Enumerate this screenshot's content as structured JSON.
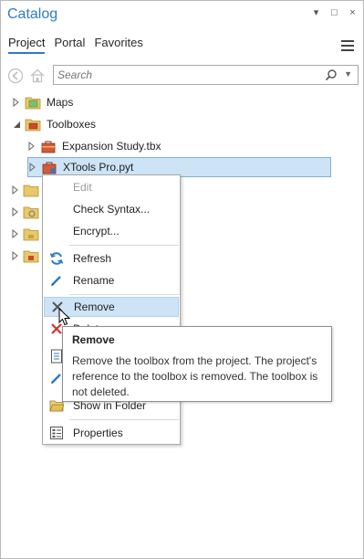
{
  "pane": {
    "title": "Catalog",
    "window_buttons": {
      "menu": "▾",
      "float": "□",
      "close": "×"
    }
  },
  "tabs": [
    {
      "label": "Project",
      "active": true
    },
    {
      "label": "Portal",
      "active": false
    },
    {
      "label": "Favorites",
      "active": false
    }
  ],
  "search": {
    "placeholder": "Search"
  },
  "tree": [
    {
      "label": "Maps",
      "icon": "maps-folder-icon"
    },
    {
      "label": "Toolboxes",
      "icon": "toolboxes-folder-icon",
      "expanded": true
    },
    {
      "label": "Expansion Study.tbx",
      "icon": "toolbox-icon"
    },
    {
      "label": "XTools Pro.pyt",
      "icon": "python-toolbox-icon",
      "selected": true
    }
  ],
  "context_menu": {
    "items": [
      {
        "label": "Edit",
        "disabled": true,
        "icon": ""
      },
      {
        "label": "Check Syntax...",
        "icon": ""
      },
      {
        "label": "Encrypt...",
        "icon": ""
      },
      {
        "label": "Refresh",
        "icon": "refresh-icon"
      },
      {
        "label": "Rename",
        "icon": "rename-icon"
      },
      {
        "label": "Remove",
        "icon": "remove-icon",
        "highlighted": true
      },
      {
        "label": "Delete",
        "icon": "delete-icon"
      },
      {
        "label": "",
        "icon": "document-icon"
      },
      {
        "label": "",
        "icon": "pencil-icon"
      },
      {
        "label": "Show in Folder",
        "icon": "folder-icon"
      },
      {
        "label": "Properties",
        "icon": "properties-icon"
      }
    ]
  },
  "tooltip": {
    "title": "Remove",
    "body": "Remove the toolbox from the project. The project's reference to the toolbox is removed. The toolbox is not deleted."
  },
  "colors": {
    "accent": "#2c7bc6",
    "selection": "#cde3f6"
  }
}
